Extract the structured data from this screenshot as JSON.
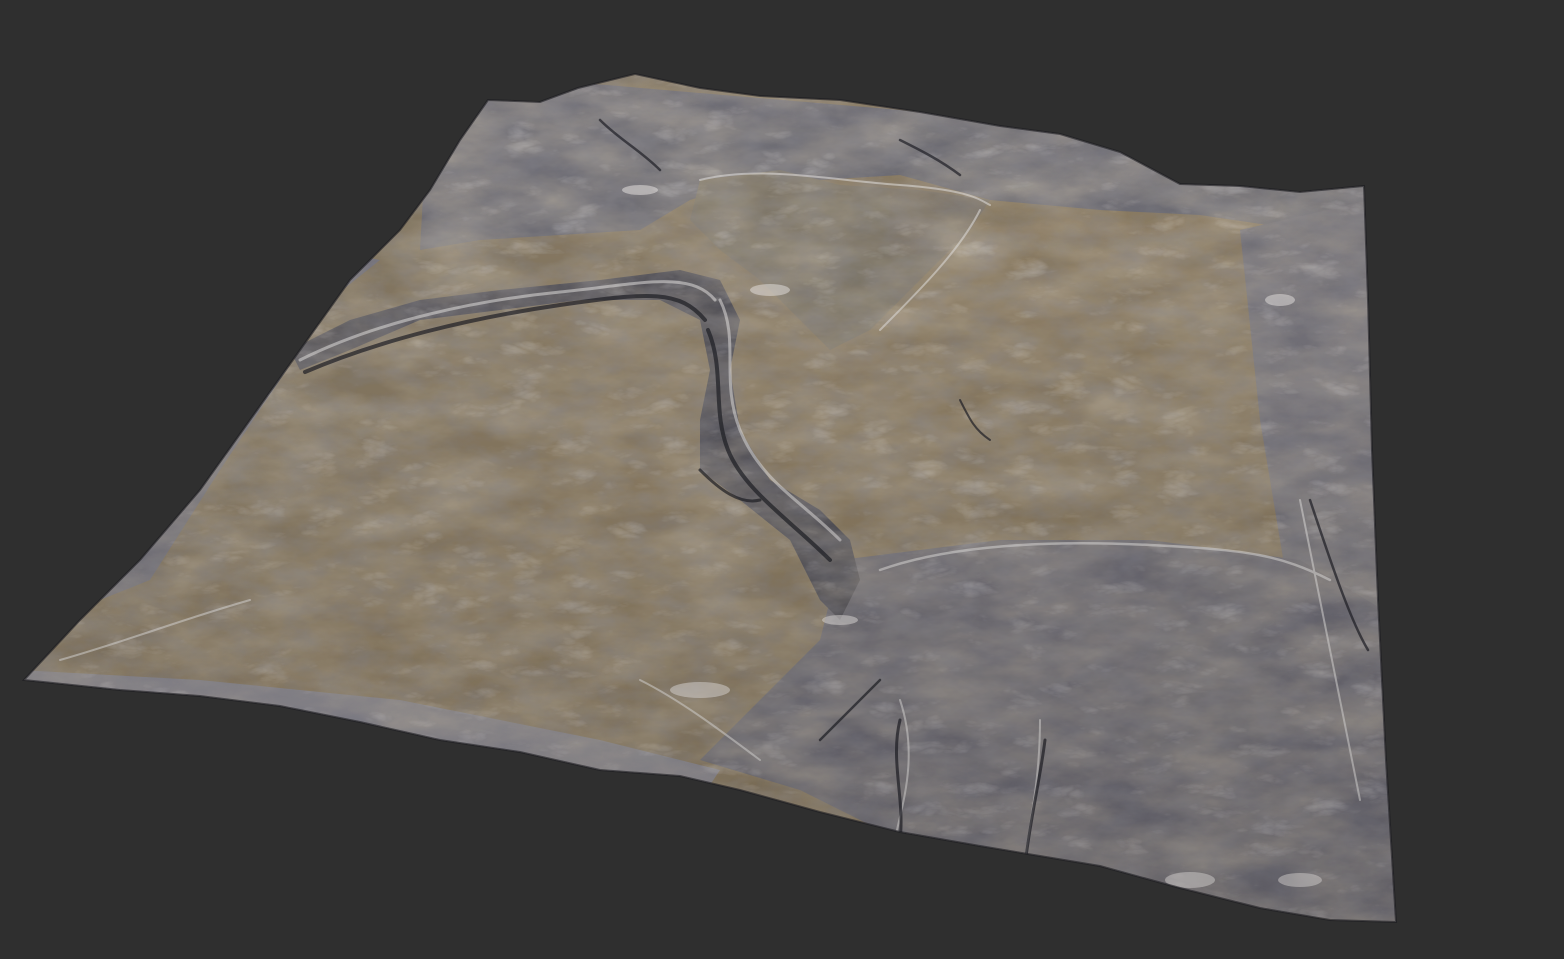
{
  "scene": {
    "background_color": "#2f2f2f",
    "subject": "terrain-heightmap-render",
    "palette": {
      "flat_ground": "#8a7a62",
      "flat_ground_light": "#a8987c",
      "rock_dark": "#3b3c44",
      "rock_mid": "#6e6e78",
      "rock_light": "#b9b8c0",
      "highlight": "#e9e6e6",
      "shadow": "#1f2026"
    }
  }
}
